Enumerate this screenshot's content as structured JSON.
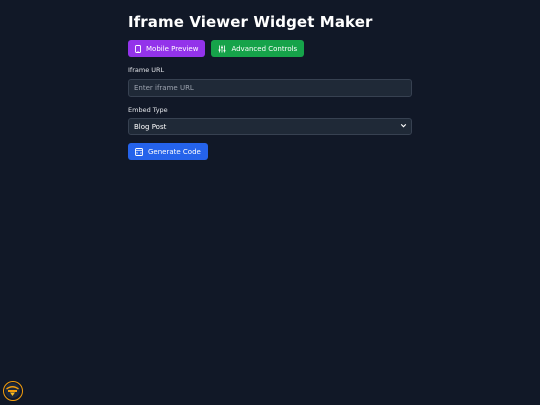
{
  "header": {
    "title": "Iframe Viewer Widget Maker"
  },
  "toolbar": {
    "mobile_preview_label": "Mobile Preview",
    "advanced_controls_label": "Advanced Controls"
  },
  "form": {
    "iframe_url": {
      "label": "Iframe URL",
      "placeholder": "Enter iframe URL",
      "value": ""
    },
    "embed_type": {
      "label": "Embed Type",
      "selected": "Blog Post"
    },
    "generate_label": "Generate Code"
  },
  "icons": {
    "mobile": "smartphone-icon",
    "advanced": "sliders-icon",
    "generate": "code-window-icon",
    "select_caret": "chevron-down-icon",
    "badge": "logo-badge"
  },
  "colors": {
    "background": "#111827",
    "purple_button": "#9333ea",
    "green_button": "#16a34a",
    "blue_button": "#2563eb",
    "input_bg": "#1f2937",
    "input_border": "#374151",
    "badge_accent": "#f59e0b"
  }
}
